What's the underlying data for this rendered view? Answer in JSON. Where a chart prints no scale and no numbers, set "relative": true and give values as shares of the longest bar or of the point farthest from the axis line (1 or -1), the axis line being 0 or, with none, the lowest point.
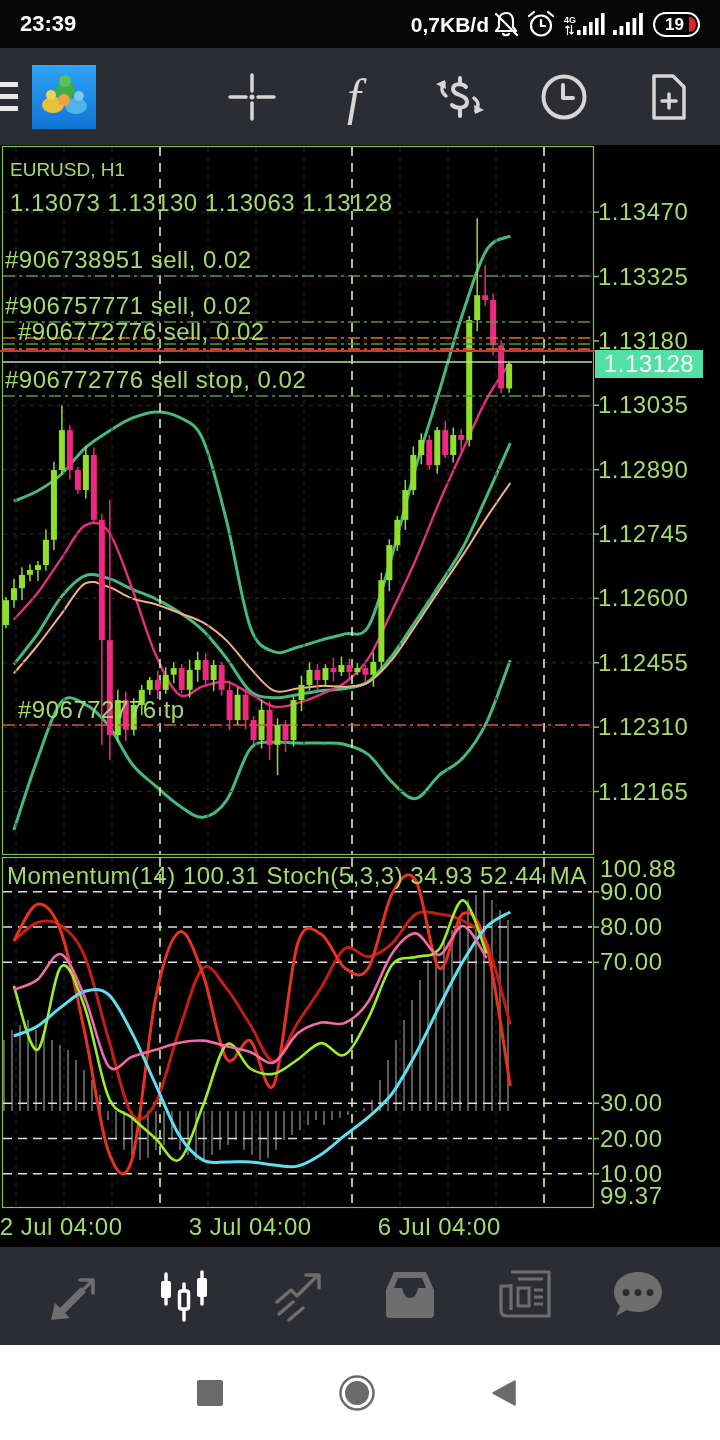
{
  "status_bar": {
    "time": "23:39",
    "data_rate": "0,7KB/d",
    "network_type": "4G",
    "battery": "19"
  },
  "toolbar": {
    "indicators_symbol": "f"
  },
  "chart": {
    "title": "EURUSD, H1",
    "ohlc": "1.13073 1.13130 1.13063 1.13128",
    "order_labels": [
      "#906738951 sell, 0.02",
      "#906757771 sell, 0.02",
      "#906772776 sell, 0.02",
      "#906772776 sell stop, 0.02",
      "#906772776 tp"
    ],
    "current_price": "1.13128",
    "chart_data": {
      "type": "candlestick",
      "grid": true,
      "categories": [
        null,
        null,
        null,
        null,
        null,
        null,
        null,
        null,
        null,
        null,
        null,
        null,
        null,
        null,
        null,
        null,
        null,
        null,
        null,
        null,
        null,
        null,
        null,
        null,
        null,
        null,
        null,
        null,
        null,
        null,
        null,
        null,
        null,
        null,
        null,
        null,
        null,
        null,
        null,
        null,
        null,
        null,
        null,
        null,
        null,
        null,
        null,
        null,
        null,
        null,
        null,
        null,
        null,
        null,
        null,
        null,
        null,
        null,
        null,
        null,
        null,
        null,
        null,
        null,
        null,
        null,
        null,
        null,
        null,
        null,
        null,
        null,
        null,
        null
      ],
      "ylim": [
        1.12022,
        1.13619
      ],
      "yticks": [
        {
          "value": 1.1347,
          "label": "1.13470"
        },
        {
          "value": 1.13325,
          "label": "1.13325"
        },
        {
          "value": 1.1318,
          "label": "1.13180"
        },
        {
          "value": 1.13035,
          "label": "1.13035"
        },
        {
          "value": 1.1289,
          "label": "1.12890"
        },
        {
          "value": 1.12745,
          "label": "1.12745"
        },
        {
          "value": 1.126,
          "label": "1.12600"
        },
        {
          "value": 1.12455,
          "label": "1.12455"
        },
        {
          "value": 1.1231,
          "label": "1.12310"
        },
        {
          "value": 1.12165,
          "label": "1.12165"
        }
      ],
      "ohlc": [
        [
          1.1254,
          1.12603,
          1.12533,
          1.12596
        ],
        [
          1.12596,
          1.12644,
          1.12579,
          1.12623
        ],
        [
          1.12623,
          1.1267,
          1.12596,
          1.12653
        ],
        [
          1.12653,
          1.12677,
          1.12638,
          1.12664
        ],
        [
          1.12664,
          1.12684,
          1.12639,
          1.12675
        ],
        [
          1.12675,
          1.12755,
          1.12662,
          1.12732
        ],
        [
          1.12732,
          1.12908,
          1.12709,
          1.12889
        ],
        [
          1.12889,
          1.13035,
          1.12878,
          1.12979
        ],
        [
          1.12979,
          1.1299,
          1.12868,
          1.12889
        ],
        [
          1.12889,
          1.12896,
          1.12835,
          1.12844
        ],
        [
          1.12844,
          1.12944,
          1.12825,
          1.12923
        ],
        [
          1.12923,
          1.1294,
          1.1277,
          1.12777
        ],
        [
          1.12777,
          1.1279,
          1.1227,
          1.12506
        ],
        [
          1.12506,
          1.12822,
          1.12236,
          1.12292
        ],
        [
          1.12292,
          1.12394,
          1.12277,
          1.12371
        ],
        [
          1.12371,
          1.1239,
          1.12279,
          1.12304
        ],
        [
          1.12304,
          1.12375,
          1.12291,
          1.1236
        ],
        [
          1.1236,
          1.12405,
          1.12337,
          1.12394
        ],
        [
          1.12394,
          1.12423,
          1.12383,
          1.12416
        ],
        [
          1.12416,
          1.12437,
          1.12373,
          1.12394
        ],
        [
          1.12394,
          1.12445,
          1.12385,
          1.12428
        ],
        [
          1.12428,
          1.12456,
          1.12409,
          1.12443
        ],
        [
          1.12443,
          1.12452,
          1.12387,
          1.12394
        ],
        [
          1.12394,
          1.12462,
          1.12377,
          1.12439
        ],
        [
          1.12439,
          1.1248,
          1.12412,
          1.12461
        ],
        [
          1.12461,
          1.12476,
          1.12401,
          1.12416
        ],
        [
          1.12416,
          1.12461,
          1.12391,
          1.1245
        ],
        [
          1.1245,
          1.12457,
          1.12381,
          1.12394
        ],
        [
          1.12394,
          1.12415,
          1.12303,
          1.12326
        ],
        [
          1.12326,
          1.124,
          1.12315,
          1.12383
        ],
        [
          1.12383,
          1.12396,
          1.12305,
          1.12326
        ],
        [
          1.12326,
          1.12335,
          1.12272,
          1.12281
        ],
        [
          1.12281,
          1.12372,
          1.12262,
          1.12349
        ],
        [
          1.12349,
          1.12368,
          1.12236,
          1.1227
        ],
        [
          1.1227,
          1.1233,
          1.12202,
          1.12315
        ],
        [
          1.12315,
          1.12326,
          1.12254,
          1.12281
        ],
        [
          1.12281,
          1.12378,
          1.12266,
          1.12371
        ],
        [
          1.12371,
          1.12426,
          1.12346,
          1.12405
        ],
        [
          1.12405,
          1.12456,
          1.12392,
          1.12439
        ],
        [
          1.12439,
          1.12452,
          1.12393,
          1.12416
        ],
        [
          1.12416,
          1.12452,
          1.12405,
          1.12443
        ],
        [
          1.12443,
          1.12466,
          1.12413,
          1.12434
        ],
        [
          1.12434,
          1.12469,
          1.12425,
          1.1245
        ],
        [
          1.1245,
          1.12465,
          1.12415,
          1.12434
        ],
        [
          1.12434,
          1.12454,
          1.12427,
          1.12443
        ],
        [
          1.12443,
          1.1245,
          1.12411,
          1.12428
        ],
        [
          1.12428,
          1.12478,
          1.12401,
          1.12457
        ],
        [
          1.12457,
          1.12658,
          1.12442,
          1.12641
        ],
        [
          1.12641,
          1.12733,
          1.12616,
          1.1272
        ],
        [
          1.1272,
          1.12786,
          1.12707,
          1.12777
        ],
        [
          1.12777,
          1.12867,
          1.12754,
          1.12844
        ],
        [
          1.12844,
          1.12942,
          1.12833,
          1.12923
        ],
        [
          1.12923,
          1.12972,
          1.12902,
          1.12957
        ],
        [
          1.12957,
          1.12968,
          1.12891,
          1.129
        ],
        [
          1.129,
          1.12986,
          1.12881,
          1.12979
        ],
        [
          1.12979,
          1.13,
          1.12916,
          1.12923
        ],
        [
          1.12923,
          1.12985,
          1.12906,
          1.12968
        ],
        [
          1.12968,
          1.12981,
          1.1293,
          1.12957
        ],
        [
          1.12957,
          1.13236,
          1.12942,
          1.13227
        ],
        [
          1.13227,
          1.13456,
          1.13202,
          1.13283
        ],
        [
          1.13283,
          1.13351,
          1.13259,
          1.13272
        ],
        [
          1.13272,
          1.13287,
          1.13147,
          1.1317
        ],
        [
          1.1317,
          1.13181,
          1.13062,
          1.13073
        ],
        [
          1.13073,
          1.1313,
          1.13063,
          1.13128
        ],
        null,
        null,
        null,
        null,
        null,
        null,
        null,
        null,
        null,
        null
      ]
    },
    "overlay": {
      "chart_data": {
        "type": "line",
        "relative": true,
        "categories": [
          null,
          null,
          null,
          null,
          null,
          null,
          null,
          null,
          null,
          null,
          null,
          null,
          null,
          null,
          null,
          null,
          null,
          null,
          null,
          null,
          null,
          null,
          null,
          null,
          null
        ],
        "ylim": [
          1.12022,
          1.13619
        ],
        "series": [
          {
            "color": "#45b97e",
            "values": [
              1.12819,
              1.12842,
              1.12879,
              1.12938,
              1.12976,
              1.13006,
              1.1302,
              1.13008,
              1.12958,
              1.12774,
              1.12536,
              1.1248,
              1.1249,
              1.12506,
              1.1252,
              1.12537,
              1.12697,
              1.12895,
              1.13067,
              1.13244,
              1.13385,
              1.13416,
              null,
              null,
              null
            ]
          },
          {
            "color": "#45b97e",
            "values": [
              1.12451,
              1.1252,
              1.12603,
              1.12651,
              1.12645,
              1.12621,
              1.12599,
              1.12569,
              1.12528,
              1.12465,
              1.12391,
              1.12376,
              1.12383,
              1.12392,
              1.12397,
              1.12413,
              1.12471,
              1.12549,
              1.1263,
              1.12715,
              1.1283,
              1.1295,
              null,
              null,
              null
            ]
          },
          {
            "color": "#45b97e",
            "values": [
              1.12078,
              1.12238,
              1.12366,
              1.12362,
              1.12314,
              1.12227,
              1.12177,
              1.12133,
              1.12107,
              1.12145,
              1.12261,
              1.12276,
              1.12274,
              1.12274,
              1.12271,
              1.12248,
              1.12186,
              1.12149,
              1.12202,
              1.12241,
              1.12321,
              1.12461,
              null,
              null,
              null
            ]
          },
          {
            "color": "#e0307f",
            "values": [
              1.12552,
              1.12612,
              1.12689,
              1.12764,
              1.12751,
              1.12623,
              1.12473,
              1.12383,
              1.12402,
              1.12412,
              1.12385,
              1.12356,
              1.12364,
              1.12384,
              1.1241,
              1.12465,
              1.12572,
              1.12687,
              1.12817,
              1.12935,
              1.13049,
              1.13132,
              null,
              null,
              null
            ]
          },
          {
            "color": "#f5b27c",
            "values": [
              1.12431,
              1.12494,
              1.12564,
              1.12633,
              1.12626,
              1.126,
              1.12587,
              1.12567,
              1.12546,
              1.12505,
              1.12443,
              1.12392,
              1.12397,
              1.12403,
              1.12401,
              1.12411,
              1.12462,
              1.12539,
              1.12619,
              1.12698,
              1.12782,
              1.1286,
              null,
              null,
              null
            ]
          }
        ]
      }
    }
  },
  "indicator_panel": {
    "legend": "Momentum(14) 100.31 Stoch(5,3,3) 34.93 52.44 MA",
    "momentum_scale": [
      "100.88",
      "99.37"
    ],
    "chart_data": {
      "type": "line",
      "grid": true,
      "categories": [
        null,
        null,
        "2 Jul 04:00",
        null,
        null,
        null,
        null,
        null,
        null,
        null,
        "3 Jul 04:00",
        null,
        null,
        null,
        null,
        null,
        null,
        null,
        "6 Jul 04:00",
        null,
        null,
        null,
        null,
        null,
        null
      ],
      "ylim": [
        0.6,
        99.6
      ],
      "yticks": [
        {
          "value": 90,
          "label": "90.00"
        },
        {
          "value": 80,
          "label": "80.00"
        },
        {
          "value": 70,
          "label": "70.00"
        },
        {
          "value": 30,
          "label": "30.00"
        },
        {
          "value": 20,
          "label": "20.00"
        },
        {
          "value": 10,
          "label": "10.00"
        }
      ],
      "series": [
        {
          "color": "#c41e12",
          "values": [
            76.1,
            81.3,
            80.4,
            71.7,
            48.4,
            26.9,
            30.2,
            50.9,
            68.4,
            62.6,
            52.3,
            41.9,
            52.8,
            62.8,
            73.9,
            71.6,
            75.4,
            83.7,
            83.7,
            81.8,
            75.6,
            52.4,
            null,
            null,
            null
          ]
        },
        {
          "color": "#e8321e",
          "values": [
            76.1,
            86.5,
            78.6,
            50.1,
            16.4,
            14.1,
            60.0,
            78.6,
            66.6,
            42.6,
            47.8,
            35.3,
            75.2,
            78.0,
            68.4,
            68.4,
            89.5,
            93.3,
            68.3,
            83.8,
            74.6,
            34.9,
            null,
            null,
            null
          ]
        },
        {
          "color": "#9aee2a",
          "values": [
            63.3,
            45.2,
            68.8,
            57.3,
            31.9,
            25.9,
            20.0,
            14.0,
            29.3,
            46.7,
            39.9,
            38.4,
            42.4,
            47.1,
            43.8,
            54.2,
            69.3,
            71.5,
            73.8,
            87.6,
            72.5,
            null,
            null,
            null,
            null
          ]
        },
        {
          "color": "#5ee0f2",
          "values": [
            49.1,
            51.9,
            57.3,
            61.8,
            60.9,
            50.0,
            35.3,
            20.9,
            13.9,
            13.4,
            13.4,
            12.5,
            12.2,
            15.5,
            20.9,
            26.1,
            32.8,
            44.0,
            57.5,
            70.3,
            80.1,
            84.3,
            null,
            null,
            null
          ]
        },
        {
          "color": "#f06aa6",
          "values": [
            62.2,
            65.1,
            72.3,
            60.1,
            40.6,
            43.2,
            45.2,
            47.2,
            47.8,
            46.2,
            44.6,
            41.6,
            49.8,
            52.9,
            52.8,
            58.9,
            72.5,
            78.2,
            72.1,
            80.3,
            71.2,
            null,
            null,
            null,
            null
          ]
        }
      ]
    }
  },
  "bottom_nav": [
    {
      "selected": false
    },
    {
      "selected": true
    },
    {
      "selected": false
    },
    {
      "selected": false
    },
    {
      "selected": false
    },
    {
      "selected": false
    }
  ]
}
